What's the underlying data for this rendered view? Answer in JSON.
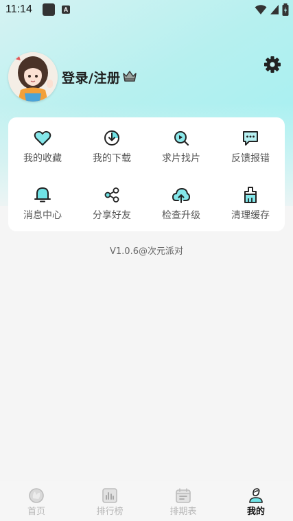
{
  "status_bar": {
    "time": "11:14"
  },
  "profile": {
    "login_label": "登录/注册"
  },
  "menu": {
    "items": [
      {
        "label": "我的收藏",
        "icon": "heart-icon"
      },
      {
        "label": "我的下载",
        "icon": "download-icon"
      },
      {
        "label": "求片找片",
        "icon": "search-film-icon"
      },
      {
        "label": "反馈报错",
        "icon": "feedback-icon"
      },
      {
        "label": "消息中心",
        "icon": "bell-icon"
      },
      {
        "label": "分享好友",
        "icon": "share-icon"
      },
      {
        "label": "检查升级",
        "icon": "cloud-upload-icon"
      },
      {
        "label": "清理缓存",
        "icon": "broom-icon"
      }
    ]
  },
  "version_text": "V1.0.6@次元派对",
  "bottom_nav": {
    "items": [
      {
        "label": "首页",
        "icon": "home-icon",
        "active": false
      },
      {
        "label": "排行榜",
        "icon": "ranking-icon",
        "active": false
      },
      {
        "label": "排期表",
        "icon": "calendar-icon",
        "active": false
      },
      {
        "label": "我的",
        "icon": "profile-icon",
        "active": true
      }
    ]
  },
  "colors": {
    "accent": "#6fe3e6",
    "icon_stroke": "#222222",
    "inactive_nav": "#b8b8b8"
  }
}
